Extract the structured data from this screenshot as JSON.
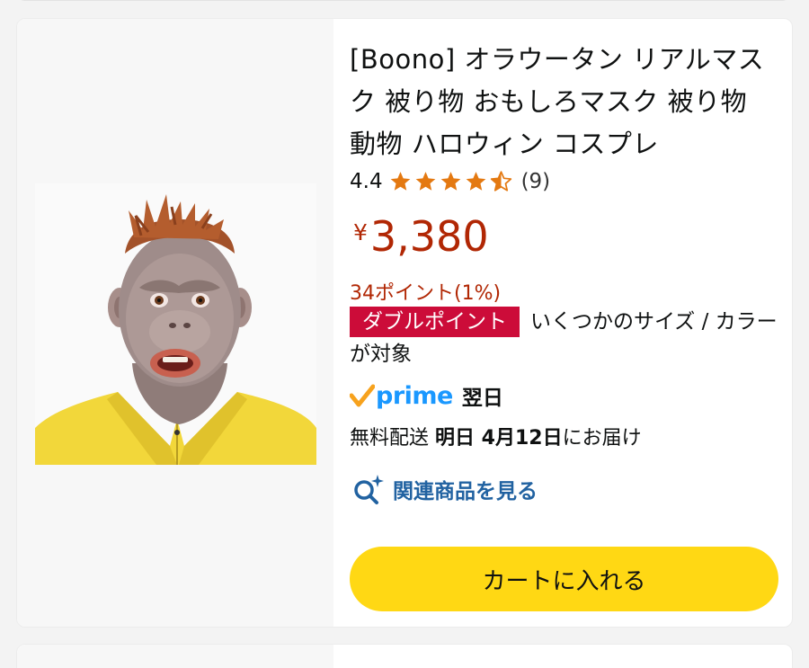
{
  "product": {
    "title": "[Boono] オラウータン リアルマスク 被り物 おもしろマスク 被り物 動物 ハロウィン コスプレ",
    "image_icon": "orangutan-mask-photo",
    "rating": {
      "value": "4.4",
      "stars": 4.4,
      "count_text": "(9)",
      "star_color": "#e47911"
    },
    "price": {
      "symbol": "¥",
      "value": "3,380",
      "color": "#b12704"
    },
    "points": "34ポイント(1%)",
    "promo": {
      "badge": "ダブルポイント",
      "text": "いくつかのサイズ / カラーが対象",
      "badge_color": "#cc0c39"
    },
    "prime": {
      "logo_text": "prime",
      "day": "翌日",
      "logo_color": "#1a98ff",
      "check_color": "#f7a21d"
    },
    "delivery": {
      "prefix": "無料配送 ",
      "bold": "明日 4月12日",
      "suffix": "にお届け"
    },
    "related": {
      "label": "関連商品を見る",
      "icon": "search-sparkle-icon"
    },
    "cart_button": {
      "label": "カートに入れる",
      "color": "#ffd814"
    }
  }
}
